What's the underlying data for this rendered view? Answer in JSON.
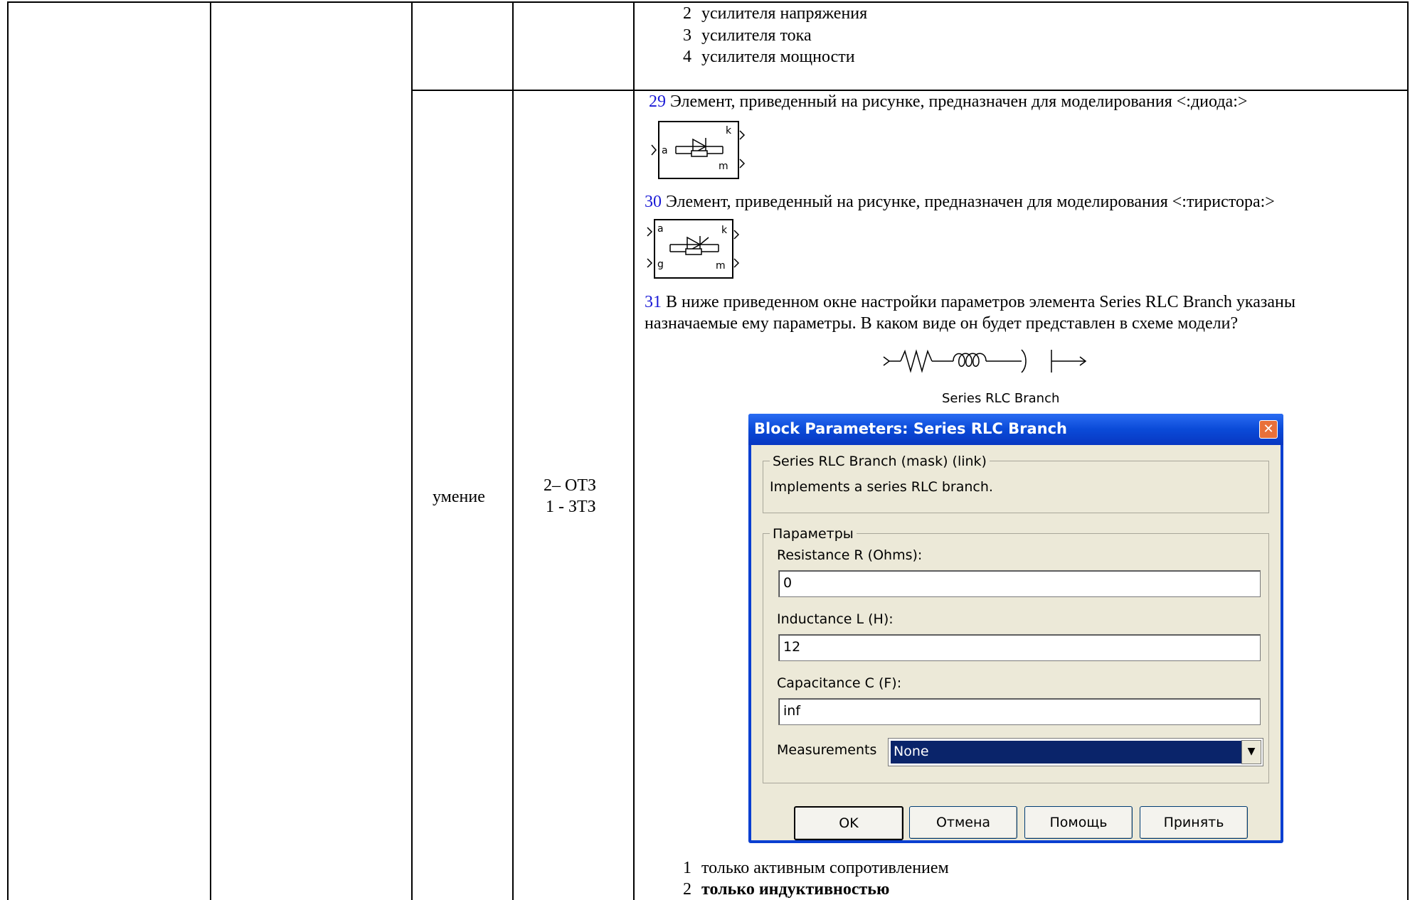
{
  "top_options": [
    {
      "num": "2",
      "text": "усилителя напряжения"
    },
    {
      "num": "3",
      "text": "усилителя тока"
    },
    {
      "num": "4",
      "text": "усилителя мощности"
    }
  ],
  "skill_cell": "умение",
  "task_cell": {
    "line1": "2– ОТЗ",
    "line2": "1 - ЗТЗ"
  },
  "questions": [
    {
      "num": "29",
      "text": " Элемент, приведенный на рисунке, предназначен для моделирования <:диода:>"
    },
    {
      "num": "30",
      "text": " Элемент, приведенный на рисунке, предназначен для моделирования <:тиристора:>"
    },
    {
      "num": "31",
      "text": " В ниже приведенном окне настройки параметров элемента Series RLC Branch указаны",
      "text2": "назначаемые ему параметры. В каком виде он будет представлен в схеме модели?"
    }
  ],
  "diode_block": {
    "port_a": "a",
    "port_k": "k",
    "port_m": "m"
  },
  "thyristor_block": {
    "port_a": "a",
    "port_g": "g",
    "port_k": "k",
    "port_m": "m"
  },
  "rlc_symbol_label": "Series RLC Branch",
  "dialog": {
    "title": "Block Parameters: Series RLC Branch",
    "close_glyph": "✕",
    "mask_group": "Series RLC Branch (mask) (link)",
    "description": "Implements a series RLC branch.",
    "params_group": "Параметры",
    "resistance_label": "Resistance R (Ohms):",
    "resistance_value": "0",
    "inductance_label": "Inductance L (H):",
    "inductance_value": "12",
    "capacitance_label": "Capacitance C (F):",
    "capacitance_value": "inf",
    "measurements_label": "Measurements",
    "measurements_value": "None",
    "buttons": {
      "ok": "OK",
      "cancel": "Отмена",
      "help": "Помощь",
      "apply": "Принять"
    }
  },
  "answers": [
    {
      "num": "1",
      "text": "только активным сопротивлением"
    },
    {
      "num": "2",
      "text": "только индуктивностью"
    }
  ]
}
